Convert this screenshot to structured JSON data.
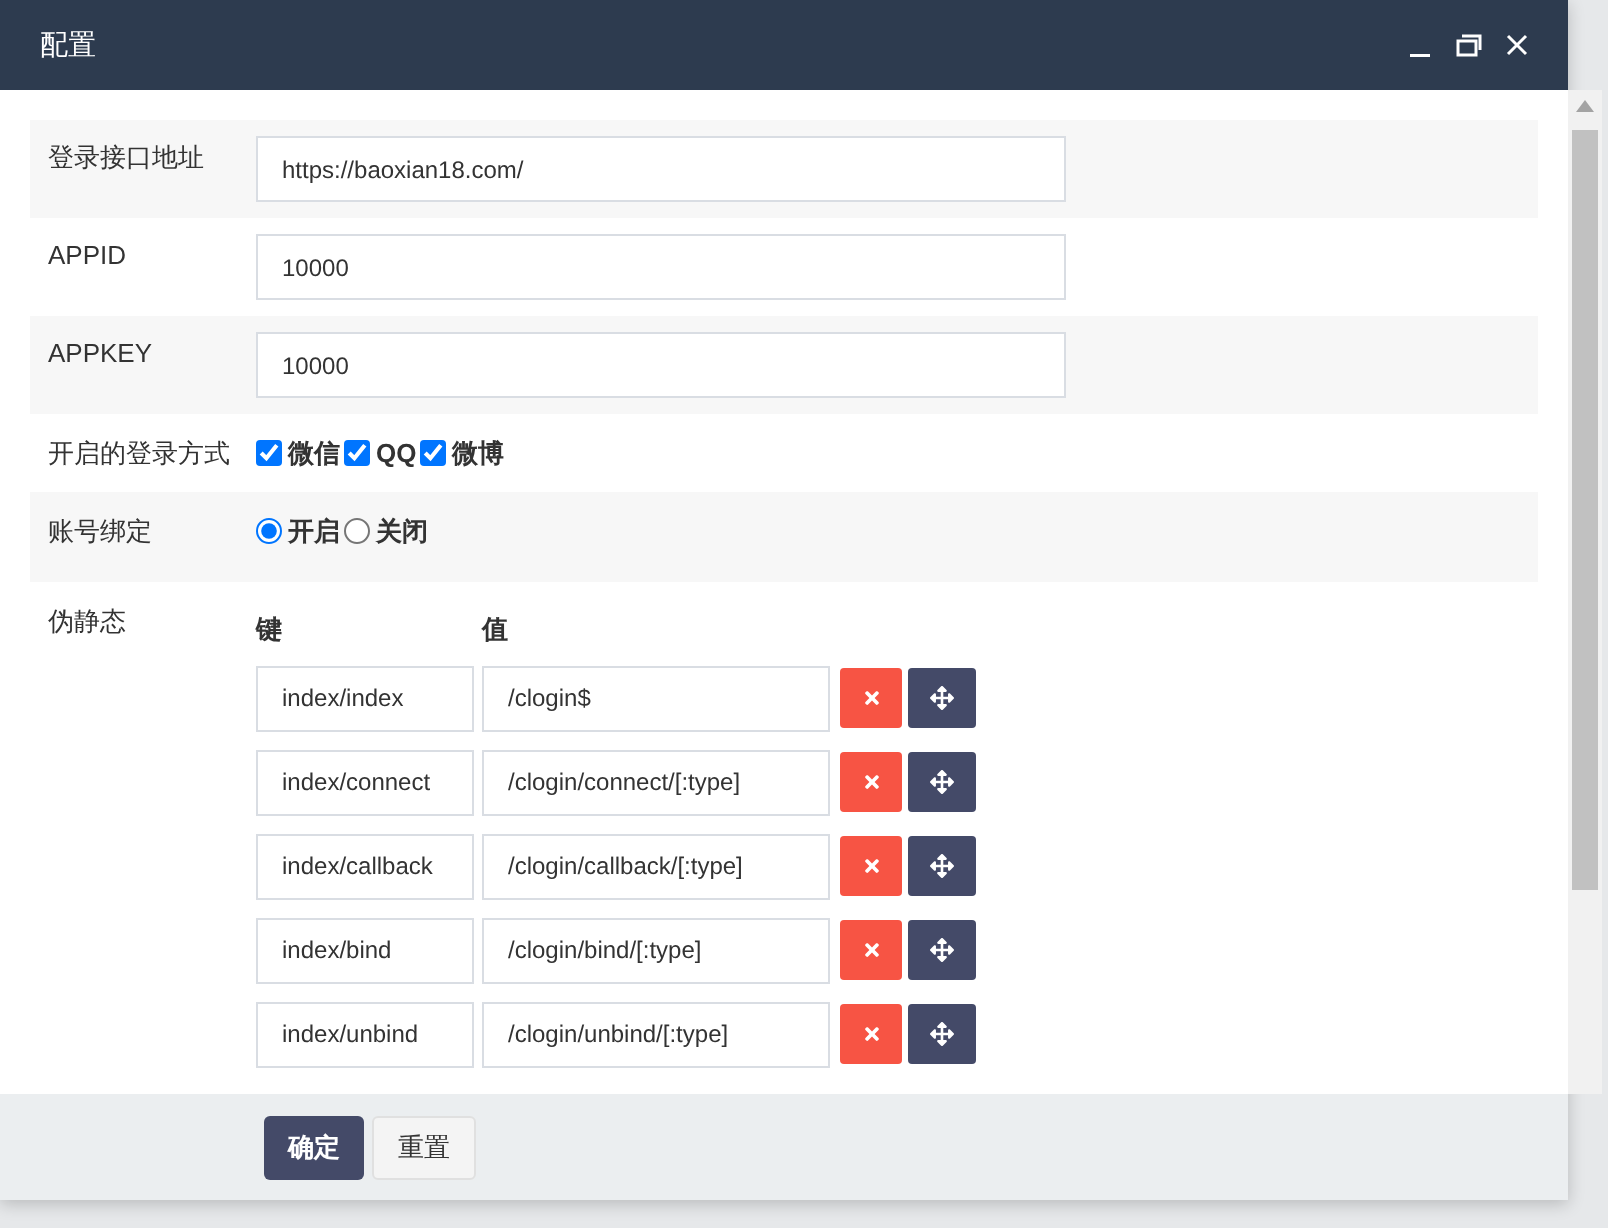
{
  "window": {
    "title": "配置"
  },
  "fields": [
    {
      "kind": "text",
      "label": "登录接口地址",
      "value": "https://baoxian18.com/"
    },
    {
      "kind": "text",
      "label": "APPID",
      "value": "10000"
    },
    {
      "kind": "text",
      "label": "APPKEY",
      "value": "10000"
    },
    {
      "kind": "checkboxes",
      "label": "开启的登录方式",
      "options": [
        {
          "label": "微信",
          "checked": true
        },
        {
          "label": "QQ",
          "checked": true
        },
        {
          "label": "微博",
          "checked": true
        }
      ]
    },
    {
      "kind": "radios",
      "label": "账号绑定",
      "options": [
        {
          "label": "开启",
          "selected": true
        },
        {
          "label": "关闭",
          "selected": false
        }
      ]
    },
    {
      "kind": "pairs",
      "label": "伪静态",
      "key_header": "键",
      "value_header": "值",
      "rows": [
        {
          "key": "index/index",
          "value": "/clogin$"
        },
        {
          "key": "index/connect",
          "value": "/clogin/connect/[:type]"
        },
        {
          "key": "index/callback",
          "value": "/clogin/callback/[:type]"
        },
        {
          "key": "index/bind",
          "value": "/clogin/bind/[:type]"
        },
        {
          "key": "index/unbind",
          "value": "/clogin/unbind/[:type]"
        }
      ]
    }
  ],
  "buttons": [
    {
      "label": "确定",
      "kind": "primary"
    },
    {
      "label": "重置",
      "kind": "default"
    }
  ]
}
